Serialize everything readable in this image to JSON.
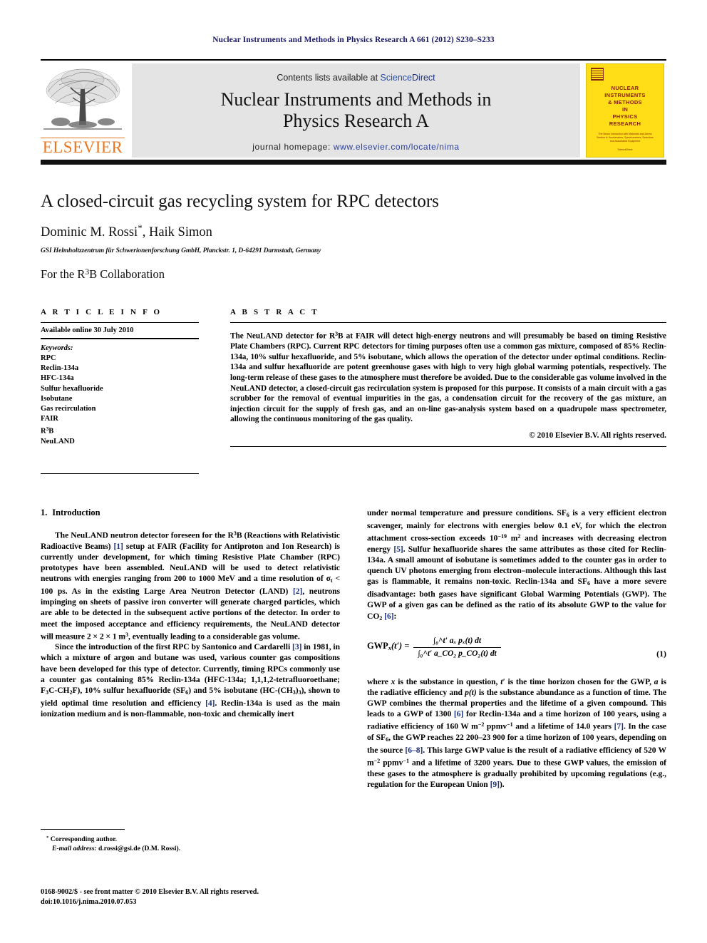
{
  "running_head": "Nuclear Instruments and Methods in Physics Research A 661 (2012) S230–S233",
  "masthead": {
    "contents_prefix": "Contents lists available at ",
    "sciencedirect_science": "Science",
    "sciencedirect_direct": "Direct",
    "journal_title_line1": "Nuclear Instruments and Methods in",
    "journal_title_line2": "Physics Research A",
    "homepage_label": "journal homepage: ",
    "homepage_url": "www.elsevier.com/locate/nima",
    "publisher_wordmark": "ELSEVIER",
    "cover": {
      "title_lines": [
        "NUCLEAR",
        "INSTRUMENTS",
        "& METHODS",
        "IN",
        "PHYSICS",
        "RESEARCH"
      ],
      "subtitle": "The Beam Interaction with Materials and Atoms Section A: Accelerators, Spectrometers, Detectors and Associated Equipment",
      "footer": "ScienceDirect"
    }
  },
  "title": "A closed-circuit gas recycling system for RPC detectors",
  "authors": "Dominic M. Rossi",
  "authors_rest": ", Haik Simon",
  "corresponding_marker": "*",
  "affiliation": "GSI Helmholtzzentrum für Schwerionenforschung GmbH, Planckstr. 1, D-64291 Darmstadt, Germany",
  "collaboration_pre": "For the R",
  "collaboration_sup": "3",
  "collaboration_post": "B Collaboration",
  "article_info": {
    "heading": "A R T I C L E  I N F O",
    "available_online": "Available online 30 July 2010",
    "keywords_heading": "Keywords:",
    "keywords": [
      "RPC",
      "Reclin-134a",
      "HFC-134a",
      "Sulfur hexafluoride",
      "Isobutane",
      "Gas recirculation",
      "FAIR",
      "R3B",
      "NeuLAND"
    ]
  },
  "abstract": {
    "heading": "A B S T R A C T",
    "text_part1": "The NeuLAND detector for R",
    "text_sup": "3",
    "text_part2": "B at FAIR will detect high-energy neutrons and will presumably be based on timing Resistive Plate Chambers (RPC). Current RPC detectors for timing purposes often use a common gas mixture, composed of 85% Reclin-134a, 10% sulfur hexafluoride, and 5% isobutane, which allows the operation of the detector under optimal conditions. Reclin-134a and sulfur hexafluoride are potent greenhouse gases with high to very high global warming potentials, respectively. The long-term release of these gases to the atmosphere must therefore be avoided. Due to the considerable gas volume involved in the NeuLAND detector, a closed-circuit gas recirculation system is proposed for this purpose. It consists of a main circuit with a gas scrubber for the removal of eventual impurities in the gas, a condensation circuit for the recovery of the gas mixture, an injection circuit for the supply of fresh gas, and an on-line gas-analysis system based on a quadrupole mass spectrometer, allowing the continuous monitoring of the gas quality.",
    "copyright": "© 2010 Elsevier B.V. All rights reserved."
  },
  "section": {
    "number": "1.",
    "title": "Introduction"
  },
  "left_column": {
    "p1_a": "The NeuLAND neutron detector foreseen for the R",
    "p1_sup": "3",
    "p1_b": "B (Reactions with Relativistic Radioactive Beams) ",
    "p1_ref1": "[1]",
    "p1_c": " setup at FAIR (Facility for Antiproton and Ion Research) is currently under development, for which timing Resistive Plate Chamber (RPC) prototypes have been assembled. NeuLAND will be used to detect relativistic neutrons with energies ranging from 200 to 1000 MeV and a time resolution of σ",
    "p1_sub": "t",
    "p1_d": " < 100 ps. As in the existing Large Area Neutron Detector (LAND) ",
    "p1_ref2": "[2]",
    "p1_e": ", neutrons impinging on sheets of passive iron converter will generate charged particles, which are able to be detected in the subsequent active portions of the detector. In order to meet the imposed acceptance and efficiency requirements, the NeuLAND detector will measure 2 × 2 × 1 m",
    "p1_sup2": "3",
    "p1_f": ", eventually leading to a considerable gas volume.",
    "p2_a": "Since the introduction of the first RPC by Santonico and Cardarelli ",
    "p2_ref3": "[3]",
    "p2_b": " in 1981, in which a mixture of argon and butane was used, various counter gas compositions have been developed for this type of detector. Currently, timing RPCs commonly use a counter gas containing 85% Reclin-134a (HFC-134a; 1,1,1,2-tetrafluoroethane; F",
    "p2_sub1": "3",
    "p2_c": "C-CH",
    "p2_sub2": "2",
    "p2_d": "F), 10% sulfur hexafluoride (SF",
    "p2_sub3": "6",
    "p2_e": ") and 5% isobutane (HC-(CH",
    "p2_sub4": "3",
    "p2_f": ")",
    "p2_sub5": "3",
    "p2_g": "), shown to yield optimal time resolution and efficiency ",
    "p2_ref4": "[4]",
    "p2_h": ". Reclin-134a is used as the main ionization medium and is non-flammable, non-toxic and chemically inert"
  },
  "right_column": {
    "p3_a": "under normal temperature and pressure conditions. SF",
    "p3_sub1": "6",
    "p3_b": " is a very efficient electron scavenger, mainly for electrons with energies below 0.1 eV, for which the electron attachment cross-section exceeds 10",
    "p3_sup1": "−19",
    "p3_c": " m",
    "p3_sup2": "2",
    "p3_d": " and increases with decreasing electron energy ",
    "p3_ref5": "[5]",
    "p3_e": ". Sulfur hexafluoride shares the same attributes as those cited for Reclin-134a. A small amount of isobutane is sometimes added to the counter gas in order to quench UV photons emerging from electron–molecule interactions. Although this last gas is flammable, it remains non-toxic. Reclin-134a and SF",
    "p3_sub2": "6",
    "p3_f": " have a more severe disadvantage: both gases have significant Global Warming Potentials (GWP). The GWP of a given gas can be defined as the ratio of its absolute GWP to the value for CO",
    "p3_sub3": "2",
    "p3_g": " ",
    "p3_ref6": "[6]",
    "p3_h": ":",
    "equation": {
      "lhs": "GWP",
      "lhs_sub": "x",
      "lhs_arg": "(t′) =",
      "numerator": "∫₀^t′ aₓ pₓ(t) dt",
      "denominator": "∫₀^t′ a_CO₂ p_CO₂(t) dt",
      "number": "(1)"
    },
    "p4_a": "where ",
    "p4_x": "x",
    "p4_b": " is the substance in question, ",
    "p4_t": "t′",
    "p4_c": " is the time horizon chosen for the GWP, ",
    "p4_aa": "a",
    "p4_d": " is the radiative efficiency and ",
    "p4_pt": "p(t)",
    "p4_e": " is the substance abundance as a function of time. The GWP combines the thermal properties and the lifetime of a given compound. This leads to a GWP of 1300 ",
    "p4_ref6": "[6]",
    "p4_f": " for Reclin-134a and a time horizon of 100 years, using a radiative efficiency of 160 W m",
    "p4_sup1": "−2",
    "p4_g": " ppmv",
    "p4_sup2": "−1",
    "p4_h": " and a lifetime of 14.0 years ",
    "p4_ref7": "[7]",
    "p4_i": ". In the case of SF",
    "p4_sub1": "6",
    "p4_j": ", the GWP reaches 22 200–23 900 for a time horizon of 100 years, depending on the source ",
    "p4_ref68": "[6–8]",
    "p4_k": ". This large GWP value is the result of a radiative efficiency of 520 W m",
    "p4_sup3": "−2",
    "p4_l": " ppmv",
    "p4_sup4": "−1",
    "p4_m": " and a lifetime of 3200 years. Due to these GWP values, the emission of these gases to the atmosphere is gradually prohibited by upcoming regulations (e.g., regulation for the European Union ",
    "p4_ref9": "[9]",
    "p4_n": ")."
  },
  "footnote": {
    "marker": "*",
    "corresponding": "Corresponding author.",
    "email_label": "E-mail address:",
    "email_value": " d.rossi@gsi.de (D.M. Rossi)."
  },
  "issn": {
    "line1": "0168-9002/$ - see front matter © 2010 Elsevier B.V. All rights reserved.",
    "line2": "doi:10.1016/j.nima.2010.07.053"
  },
  "colors": {
    "running_head": "#1a1a66",
    "link_blue": "#2b3f9e",
    "ref_blue": "#1b2f7a",
    "elsevier_orange": "#E87722",
    "cover_yellow": "#FFDE17",
    "banner_gray": "#e4e4e4"
  }
}
